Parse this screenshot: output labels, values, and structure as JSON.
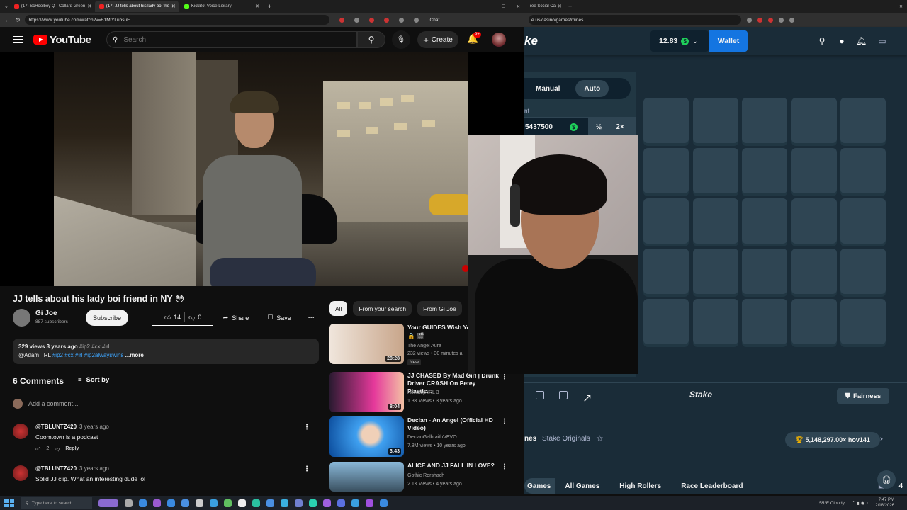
{
  "browser_left": {
    "tabs": [
      {
        "label": "(17) ScHoolboy Q - Collard Green",
        "color": "#e22"
      },
      {
        "label": "(17) JJ tells about his lady boi frie",
        "color": "#e22"
      },
      {
        "label": "KickBot Voice Library",
        "color": "#53fc18"
      }
    ],
    "url": "https://www.youtube.com/watch?v=B1MlYLubsuE"
  },
  "browser_right": {
    "tab": "ree Social Ca",
    "url": "e.us/casino/games/mines",
    "chat_label": "Chat"
  },
  "youtube": {
    "logo": "YouTube",
    "search_placeholder": "Search",
    "create_label": "Create",
    "notif_count": "9+",
    "video_title": "JJ tells about his lady boi friend in NY 😳",
    "channel": "Gi Joe",
    "subscribers": "887 subscribers",
    "subscribe_label": "Subscribe",
    "likes": "14",
    "dislikes": "0",
    "share_label": "Share",
    "save_label": "Save",
    "desc_views": "329 views  3 years ago",
    "desc_tags": "#ip2 #cx #irl",
    "desc_line2_user": "@Adam_IRL",
    "desc_line2_tags": "#ip2 #cx #irl #ip2alwayswins",
    "desc_more": "...more",
    "comments_count": "6 Comments",
    "sort_label": "Sort by",
    "add_comment": "Add a comment...",
    "comments": [
      {
        "user": "@TBLUNTZ420",
        "time": "3 years ago",
        "text": "Coomtown is a podcast",
        "likes": "2",
        "reply": "Reply"
      },
      {
        "user": "@TBLUNTZ420",
        "time": "3 years ago",
        "text": "Solid JJ clip. What an interesting dude lol",
        "likes": "",
        "reply": ""
      }
    ],
    "chips": [
      "All",
      "From your search",
      "From Gi Joe"
    ],
    "recommendations": [
      {
        "title": "Your GUIDES Wish Yo",
        "title2": "🔒 🎬",
        "channel": "The Angel Aura",
        "meta": "232 views • 30 minutes a",
        "badge": "New",
        "duration": "28:28",
        "c1": "#f0e6dc",
        "c2": "#c8a58a"
      },
      {
        "title": "JJ CHASED By Mad Girl | Drunk Driver CRASH On Petey Plastic...",
        "channel": "Nonstop IRL 3",
        "meta": "1.3K views • 3 years ago",
        "duration": "8:04",
        "c1": "#e5399b",
        "c2": "#2a1a30"
      },
      {
        "title": "Declan - An Angel (Official HD Video)",
        "channel": "DeclanGalbraithVEVO",
        "meta": "7.8M views • 10 years ago",
        "duration": "3:43",
        "c1": "#3fa0f0",
        "c2": "#0a4a9a"
      },
      {
        "title": "ALICE AND JJ FALL IN LOVE?",
        "channel": "Gothic Rorshach",
        "meta": "2.1K views • 4 years ago",
        "duration": "",
        "c1": "#8ab8d8",
        "c2": "#3a5060"
      }
    ]
  },
  "stake": {
    "logo": "ke",
    "balance": "12.83",
    "wallet_label": "Wallet",
    "mode_manual": "Manual",
    "mode_auto": "Auto",
    "bet_label": "nt",
    "bet_value": "5437500",
    "half_label": "½",
    "double_label": "2×",
    "stake_mark": "Stake",
    "fairness_label": "Fairness",
    "game_name": "nes",
    "originals_label": "Stake Originals",
    "record_label": "5,148,297.00× hov141",
    "nav_tabs": [
      "Games",
      "All Games",
      "High Rollers",
      "Race Leaderboard"
    ],
    "chat_count": "4"
  },
  "taskbar": {
    "search_placeholder": "Type here to search",
    "weather": "55°F Cloudy",
    "time": "7:47 PM",
    "date": "2/18/2026"
  }
}
